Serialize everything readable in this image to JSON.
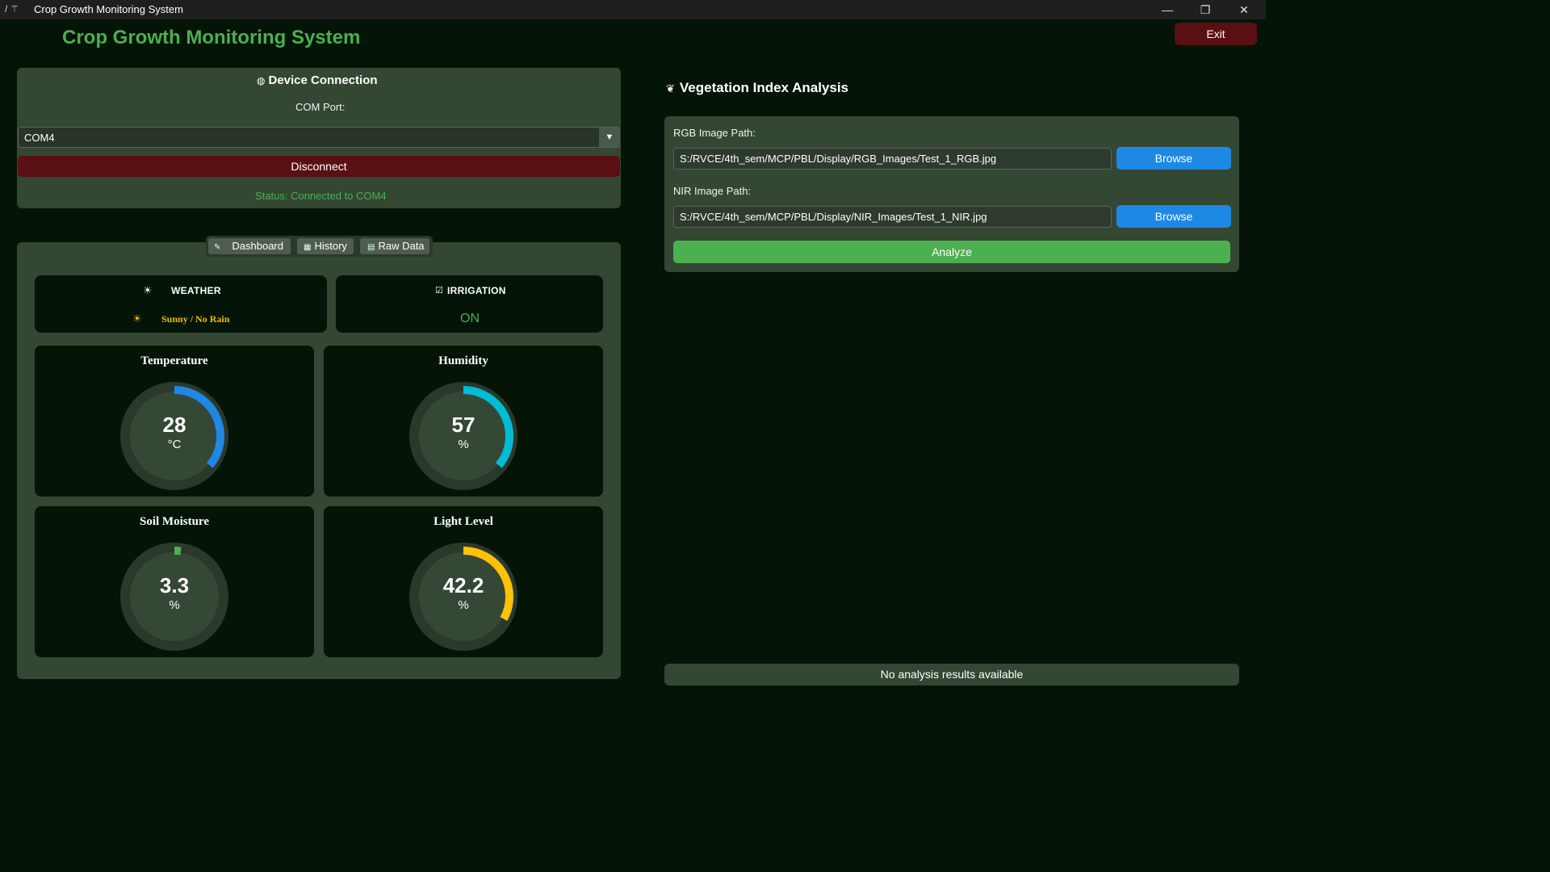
{
  "window": {
    "title": "Crop Growth Monitoring System",
    "minimize": "—",
    "restore": "❐",
    "close": "✕"
  },
  "header": {
    "title": "Crop Growth Monitoring System",
    "exit_label": "Exit"
  },
  "device": {
    "heading": "Device Connection",
    "com_port_label": "COM Port:",
    "com_port_value": "COM4",
    "disconnect_label": "Disconnect",
    "status": "Status: Connected to COM4"
  },
  "tabs": [
    {
      "label": "Dashboard",
      "icon": "dashboard-icon"
    },
    {
      "label": "History",
      "icon": "chart-icon"
    },
    {
      "label": "Raw Data",
      "icon": "clipboard-icon"
    }
  ],
  "weather": {
    "title": "WEATHER",
    "value": "Sunny / No Rain",
    "icon": "sun-icon"
  },
  "irrigation": {
    "title": "IRRIGATION",
    "value": "ON",
    "icon": "checkbox-icon"
  },
  "gauges": [
    {
      "title": "Temperature",
      "value": "28",
      "unit": "°C",
      "fraction": 0.36,
      "color": "#1e88e5"
    },
    {
      "title": "Humidity",
      "value": "57",
      "unit": "%",
      "fraction": 0.36,
      "color": "#00bcd4"
    },
    {
      "title": "Soil Moisture",
      "value": "3.3",
      "unit": "%",
      "fraction": 0.02,
      "color": "#4caf50"
    },
    {
      "title": "Light Level",
      "value": "42.2",
      "unit": "%",
      "fraction": 0.33,
      "color": "#ffc107"
    }
  ],
  "vegetation": {
    "heading": "Vegetation Index Analysis",
    "rgb_label": "RGB Image Path:",
    "rgb_path": "S:/RVCE/4th_sem/MCP/PBL/Display/RGB_Images/Test_1_RGB.jpg",
    "nir_label": "NIR Image Path:",
    "nir_path": "S:/RVCE/4th_sem/MCP/PBL/Display/NIR_Images/Test_1_NIR.jpg",
    "browse_label": "Browse",
    "analyze_label": "Analyze",
    "results": "No analysis results available"
  },
  "colors": {
    "accent_green": "#4caf50",
    "danger": "#5a0f12",
    "primary_blue": "#1e88e5",
    "panel": "#334733",
    "background": "#041507"
  }
}
